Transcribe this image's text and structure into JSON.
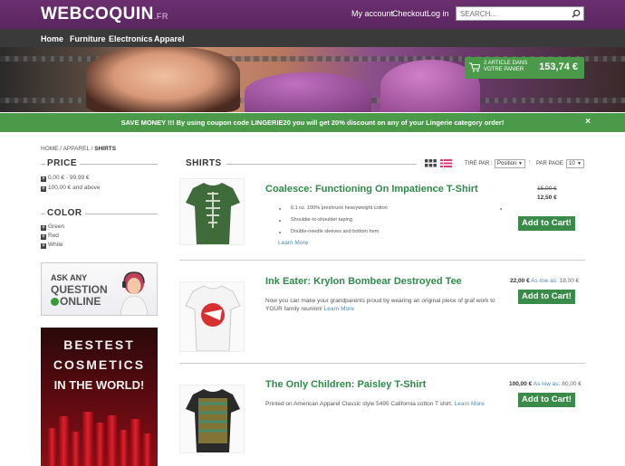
{
  "header": {
    "logo_main": "WEBCOQUIN",
    "logo_suffix": ".FR",
    "links": [
      "My account",
      "Checkout",
      "Log in"
    ],
    "search_placeholder": "SEARCH..."
  },
  "nav": [
    "Home",
    "Furniture",
    "Electronics",
    "Apparel"
  ],
  "cart": {
    "line1": "2 ARTICLE DANS",
    "line2": "VOTRE PANIER",
    "total": "153,74 €"
  },
  "promo": {
    "text": "SAVE MONEY !!! By using coupon code LINGERIE20 you will get 20% discount on any of your Lingerie category order!",
    "close": "×"
  },
  "breadcrumb": {
    "home": "HOME",
    "sep": " / ",
    "apparel": "APPAREL",
    "current": "SHIRTS"
  },
  "sidebar": {
    "price_title": "PRICE",
    "price_filters": [
      "0,00 € - 99,99 €",
      "100,00 € and above"
    ],
    "color_title": "COLOR",
    "color_filters": [
      "Green",
      "Red",
      "White"
    ],
    "ask": {
      "line1": "ASK ANY",
      "line2": "QUESTION",
      "line3": "ONLINE"
    },
    "cosmetics": {
      "line1": "BESTEST",
      "line2": "COSMETICS",
      "line3": "IN THE WORLD!"
    }
  },
  "main": {
    "title": "SHIRTS",
    "sort_label": "TIRÉ PAR :",
    "sort_value": "Position",
    "perpage_label": "PAR PAGE",
    "perpage_value": "10"
  },
  "products": [
    {
      "name": "Coalesce: Functioning On Impatience T-Shirt",
      "bullets": [
        "6.1 oz. 100% preshrunk heavyweight cotton",
        "Shoulder-to-shoulder taping",
        "Double-needle sleeves and bottom hem"
      ],
      "learn_more": "Learn More",
      "old_price": "15,00 €",
      "price": "12,50 €",
      "add_to_cart": "Add to Cart!"
    },
    {
      "name": "Ink Eater: Krylon Bombear Destroyed Tee",
      "description": "Now you can make your grandparents proud by wearing an original piece of graf work to YOUR family reunion!",
      "learn_more": "Learn More",
      "price": "22,00 €",
      "as_low_as_label": "As low as:",
      "as_low_as": "18,00 €",
      "add_to_cart": "Add to Cart!"
    },
    {
      "name": "The Only Children: Paisley T-Shirt",
      "description": "Printed on American Apparel Classic style 5495 California cotton T shirt.",
      "learn_more": "Learn More",
      "price": "100,00 €",
      "as_low_as_label": "As low as:",
      "as_low_as": "80,00 €",
      "add_to_cart": "Add to Cart!"
    }
  ],
  "colors": {
    "brand_purple": "#5a2660",
    "accent_green": "#4a9a4a",
    "product_title_green": "#2f8a4a",
    "link_blue": "#4a8ab0"
  },
  "icons": [
    "search-icon",
    "cart-icon",
    "close-icon",
    "grid-view-icon",
    "list-view-icon",
    "sort-arrow-icon",
    "plus-box-icon",
    "agent-icon"
  ]
}
